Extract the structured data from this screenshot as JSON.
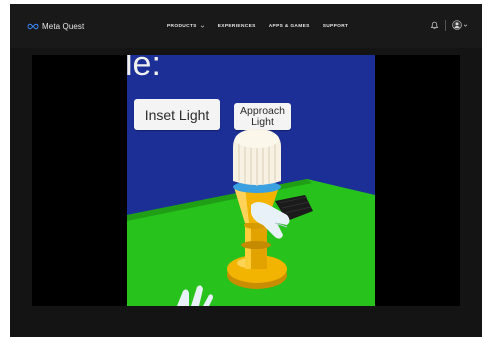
{
  "brand": {
    "name": "Meta Quest",
    "logo_icon": "meta-infinity-icon"
  },
  "nav": {
    "items": [
      {
        "label": "PRODUCTS",
        "has_dropdown": true
      },
      {
        "label": "EXPERIENCES",
        "has_dropdown": false
      },
      {
        "label": "APPS & GAMES",
        "has_dropdown": false
      },
      {
        "label": "SUPPORT",
        "has_dropdown": false
      }
    ]
  },
  "header_icons": [
    "bell-icon",
    "avatar-icon",
    "chevron-down-icon"
  ],
  "video": {
    "wall_text": "le:",
    "signs": {
      "inset": "Inset Light",
      "approach_line1": "Approach",
      "approach_line2": "Light"
    }
  },
  "colors": {
    "page_bg": "#141414",
    "topbar_bg": "#191919",
    "sky": "#1b2f96",
    "floor": "#27c21b",
    "light_body": "#f2b400"
  }
}
